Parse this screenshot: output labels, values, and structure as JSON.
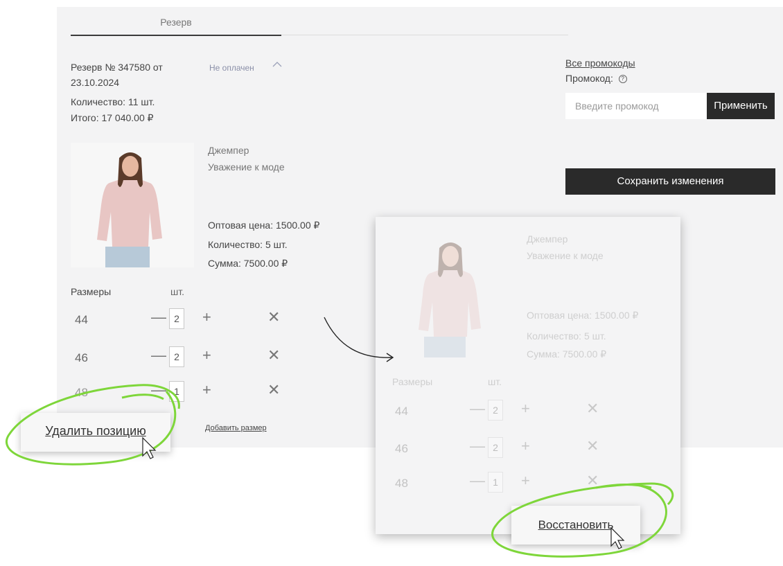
{
  "tab": {
    "label": "Резерв"
  },
  "reserve": {
    "title": "Резерв № 347580 от 23.10.2024",
    "quantity": "Количество: 11 шт.",
    "total": "Итого: 17 040.00 ₽",
    "status": "Не оплачен"
  },
  "promo": {
    "all_link": "Все промокоды",
    "label": "Промокод:",
    "placeholder": "Введите промокод",
    "apply": "Применить",
    "save": "Сохранить изменения"
  },
  "product": {
    "name": "Джемпер",
    "brand": "Уважение к моде",
    "price": "Оптовая цена: 1500.00 ₽",
    "quantity": "Количество: 5 шт.",
    "sum": "Сумма: 7500.00 ₽"
  },
  "sizes": {
    "header_sizes": "Размеры",
    "header_pcs": "шт.",
    "rows": [
      {
        "size": "44",
        "qty": "2"
      },
      {
        "size": "46",
        "qty": "2"
      },
      {
        "size": "48",
        "qty": "1"
      }
    ],
    "add_size": "Добавить размер"
  },
  "actions": {
    "delete": "Удалить позицию",
    "restore": "Восстановить"
  },
  "colors": {
    "accent_green": "#7ed63a",
    "dark_button": "#2a2a2a",
    "panel_bg": "#f3f3f4"
  }
}
